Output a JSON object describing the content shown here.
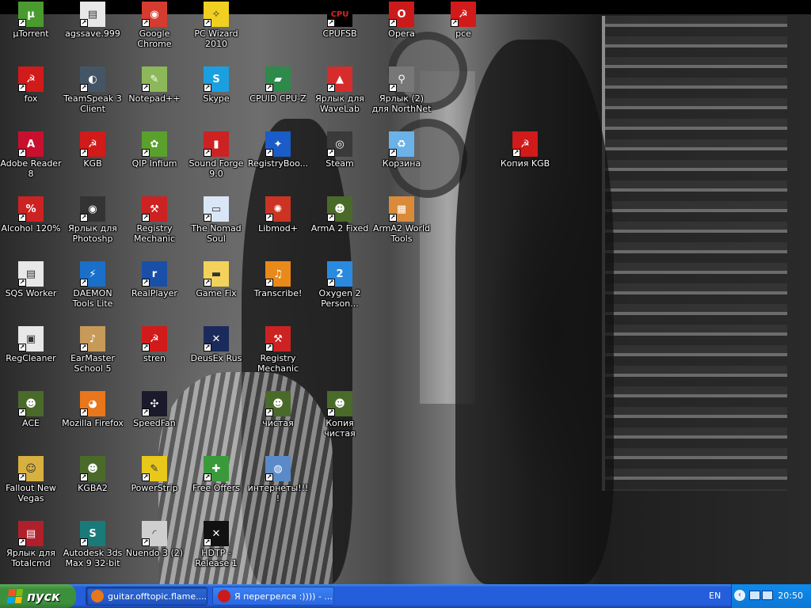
{
  "desktop": {
    "icons": [
      {
        "label": "µTorrent",
        "icon": "utorrent-icon",
        "bg": "#4a9b2f",
        "glyph": "µ"
      },
      {
        "label": "agssave.999",
        "icon": "file-icon",
        "bg": "#e8e8e8",
        "glyph": "▤"
      },
      {
        "label": "Google Chrome",
        "icon": "chrome-icon",
        "bg": "#d63b2f",
        "glyph": "◉"
      },
      {
        "label": "PC Wizard 2010",
        "icon": "pc-wizard-icon",
        "bg": "#f0d020",
        "glyph": "✧"
      },
      {
        "label": "CPUFSB",
        "icon": "cpufsb-icon",
        "bg": "#000000",
        "glyph": "CPU"
      },
      {
        "label": "Opera",
        "icon": "opera-icon",
        "bg": "#cc1a1a",
        "glyph": "O"
      },
      {
        "label": "pce",
        "icon": "hammer-sickle-icon",
        "bg": "#d11a1a",
        "glyph": "☭"
      },
      {
        "label": "fox",
        "icon": "hammer-sickle-icon",
        "bg": "#d11a1a",
        "glyph": "☭"
      },
      {
        "label": "TeamSpeak 3 Client",
        "icon": "teamspeak-icon",
        "bg": "#445566",
        "glyph": "◐"
      },
      {
        "label": "Notepad++",
        "icon": "notepad-icon",
        "bg": "#8cb85a",
        "glyph": "✎"
      },
      {
        "label": "Skype",
        "icon": "skype-icon",
        "bg": "#1aa0e0",
        "glyph": "S"
      },
      {
        "label": "CPUID CPU-Z",
        "icon": "cpuz-icon",
        "bg": "#2d8a4a",
        "glyph": "▰"
      },
      {
        "label": "Ярлык для WaveLab",
        "icon": "wavelab-icon",
        "bg": "#d62c2c",
        "glyph": "▲"
      },
      {
        "label": "Ярлык (2) для NorthNet",
        "icon": "northnet-icon",
        "bg": "#777777",
        "glyph": "⚲"
      },
      {
        "label": "Adobe Reader 8",
        "icon": "adobe-reader-icon",
        "bg": "#c8102e",
        "glyph": "A"
      },
      {
        "label": "KGB",
        "icon": "hammer-sickle-icon",
        "bg": "#d11a1a",
        "glyph": "☭"
      },
      {
        "label": "QIP Infium",
        "icon": "qip-icon",
        "bg": "#5aa02c",
        "glyph": "✿"
      },
      {
        "label": "Sound Forge 9.0",
        "icon": "sound-forge-icon",
        "bg": "#cc2222",
        "glyph": "▮"
      },
      {
        "label": "RegistryBoo...",
        "icon": "registry-booster-icon",
        "bg": "#1a5cc8",
        "glyph": "✦"
      },
      {
        "label": "Steam",
        "icon": "steam-icon",
        "bg": "#3a3a3a",
        "glyph": "◎"
      },
      {
        "label": "Корзина",
        "icon": "recycle-bin-icon",
        "bg": "#6bb2e8",
        "glyph": "♻"
      },
      {
        "label": "Копия KGB",
        "icon": "hammer-sickle-icon",
        "bg": "#d11a1a",
        "glyph": "☭"
      },
      {
        "label": "Alcohol 120%",
        "icon": "alcohol-icon",
        "bg": "#cc2222",
        "glyph": "%"
      },
      {
        "label": "Ярлык для Photoshp",
        "icon": "photoshop-icon",
        "bg": "#333333",
        "glyph": "◉"
      },
      {
        "label": "Registry Mechanic",
        "icon": "registry-mechanic-icon",
        "bg": "#cc2222",
        "glyph": "⚒"
      },
      {
        "label": "The Nomad Soul",
        "icon": "window-icon",
        "bg": "#d9e6f5",
        "glyph": "▭"
      },
      {
        "label": "Libmod+",
        "icon": "libmod-icon",
        "bg": "#cc3322",
        "glyph": "✺"
      },
      {
        "label": "ArmA 2 Fixed",
        "icon": "arma-icon",
        "bg": "#4a6a2a",
        "glyph": "☻"
      },
      {
        "label": "ArmA2 World Tools",
        "icon": "bricks-icon",
        "bg": "#d98b3a",
        "glyph": "▦"
      },
      {
        "label": "SQS Worker",
        "icon": "sqs-icon",
        "bg": "#e8e8e8",
        "glyph": "▤"
      },
      {
        "label": "DAEMON Tools Lite",
        "icon": "daemon-tools-icon",
        "bg": "#1a6fc8",
        "glyph": "⚡"
      },
      {
        "label": "RealPlayer",
        "icon": "realplayer-icon",
        "bg": "#1a4fa8",
        "glyph": "r"
      },
      {
        "label": "Game Fix",
        "icon": "folder-icon",
        "bg": "#f2d25a",
        "glyph": "▬"
      },
      {
        "label": "Transcribe!",
        "icon": "transcribe-icon",
        "bg": "#e88a1a",
        "glyph": "♫"
      },
      {
        "label": "Oxygen 2 Person...",
        "icon": "oxygen-icon",
        "bg": "#2a8ae0",
        "glyph": "2"
      },
      {
        "label": "RegCleaner",
        "icon": "regcleaner-icon",
        "bg": "#e8e8e8",
        "glyph": "▣"
      },
      {
        "label": "EarMaster School 5",
        "icon": "earmaster-icon",
        "bg": "#c89a5a",
        "glyph": "♪"
      },
      {
        "label": "stren",
        "icon": "hammer-sickle-icon",
        "bg": "#d11a1a",
        "glyph": "☭"
      },
      {
        "label": "DeusEx Rus",
        "icon": "deusex-icon",
        "bg": "#1a2a5a",
        "glyph": "✕"
      },
      {
        "label": "Registry Mechanic",
        "icon": "registry-mechanic-icon",
        "bg": "#cc2222",
        "glyph": "⚒"
      },
      {
        "label": "ACE",
        "icon": "arma-icon",
        "bg": "#4a6a2a",
        "glyph": "☻"
      },
      {
        "label": "Mozilla Firefox",
        "icon": "firefox-icon",
        "bg": "#e8761a",
        "glyph": "◕"
      },
      {
        "label": "SpeedFan",
        "icon": "speedfan-icon",
        "bg": "#1a1a2a",
        "glyph": "✣"
      },
      {
        "label": "чистая",
        "icon": "arma-icon",
        "bg": "#4a6a2a",
        "glyph": "☻"
      },
      {
        "label": "Копия чистая",
        "icon": "arma-icon",
        "bg": "#4a6a2a",
        "glyph": "☻"
      },
      {
        "label": "Fallout New Vegas",
        "icon": "fallout-icon",
        "bg": "#d8b040",
        "glyph": "☺"
      },
      {
        "label": "KGBA2",
        "icon": "arma-icon",
        "bg": "#4a6a2a",
        "glyph": "☻"
      },
      {
        "label": "PowerStrip",
        "icon": "powerstrip-icon",
        "bg": "#e8c81a",
        "glyph": "✎"
      },
      {
        "label": "Free Offers",
        "icon": "gift-icon",
        "bg": "#3a9a3a",
        "glyph": "✚"
      },
      {
        "label": "интернеты!!!!",
        "icon": "network-icon",
        "bg": "#5a8ac8",
        "glyph": "◍"
      },
      {
        "label": "Ярлык для Totalcmd",
        "icon": "totalcmd-icon",
        "bg": "#b0202a",
        "glyph": "▤"
      },
      {
        "label": "Autodesk 3ds Max 9 32-bit",
        "icon": "3dsmax-icon",
        "bg": "#1a7a7a",
        "glyph": "S"
      },
      {
        "label": "Nuendo 3 (2)",
        "icon": "nuendo-icon",
        "bg": "#cfcfcf",
        "glyph": "◜"
      },
      {
        "label": "HDTP - Release 1",
        "icon": "hdtp-icon",
        "bg": "#111111",
        "glyph": "✕"
      }
    ]
  },
  "taskbar": {
    "start_label": "пуск",
    "tasks": [
      {
        "label": "guitar.offtopic.flame....",
        "icon": "firefox-icon",
        "color": "#e8761a"
      },
      {
        "label": "Я перегрелся :)))) - ...",
        "icon": "opera-icon",
        "color": "#cc1a1a"
      }
    ],
    "language": "EN",
    "clock": "20:50"
  }
}
